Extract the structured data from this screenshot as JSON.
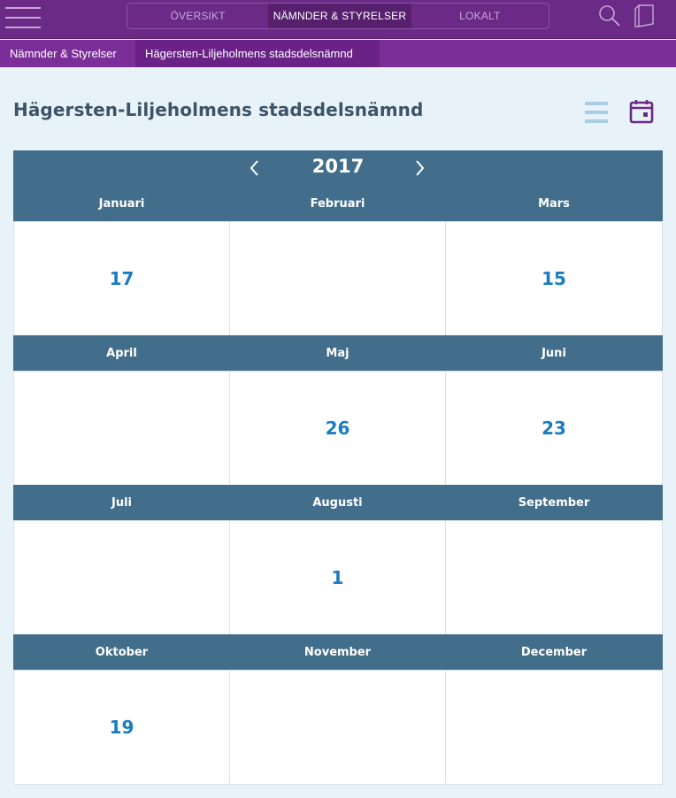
{
  "nav": {
    "tabs": [
      {
        "label": "ÖVERSIKT"
      },
      {
        "label": "NÄMNDER & STYRELSER"
      },
      {
        "label": "LOKALT"
      }
    ]
  },
  "breadcrumb": {
    "items": [
      {
        "label": "Nämnder & Styrelser"
      },
      {
        "label": "Hägersten-Liljeholmens stadsdelsnämnd"
      }
    ]
  },
  "page": {
    "title": "Hägersten-Liljeholmens stadsdelsnämnd"
  },
  "calendar": {
    "year": "2017",
    "months": [
      {
        "name": "Januari",
        "day": "17"
      },
      {
        "name": "Februari",
        "day": ""
      },
      {
        "name": "Mars",
        "day": "15"
      },
      {
        "name": "April",
        "day": ""
      },
      {
        "name": "Maj",
        "day": "26"
      },
      {
        "name": "Juni",
        "day": "23"
      },
      {
        "name": "Juli",
        "day": ""
      },
      {
        "name": "Augusti",
        "day": "1"
      },
      {
        "name": "September",
        "day": ""
      },
      {
        "name": "Oktober",
        "day": "19"
      },
      {
        "name": "November",
        "day": ""
      },
      {
        "name": "December",
        "day": ""
      }
    ]
  },
  "icons": {
    "menu": "hamburger-menu-icon",
    "search": "search-icon",
    "book": "book-icon",
    "list_view": "list-view-icon",
    "calendar_view": "calendar-view-icon",
    "prev": "chevron-left-icon",
    "next": "chevron-right-icon"
  },
  "colors": {
    "topbar": "#6a2a86",
    "breadcrumb": "#7b2e98",
    "calendar_header": "#426e8c",
    "day_link": "#1b7bc2",
    "title": "#3d5468",
    "background": "#e8f3f9"
  }
}
